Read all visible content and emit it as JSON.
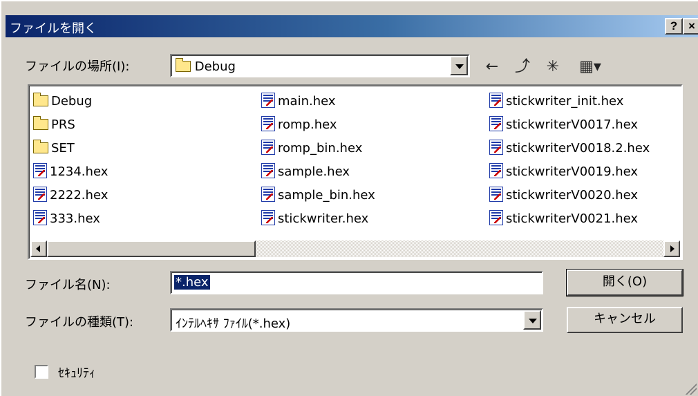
{
  "window": {
    "title": "ファイルを開く",
    "help_label": "?",
    "close_label": "×"
  },
  "location": {
    "label": "ファイルの場所(I):",
    "value": "Debug"
  },
  "toolbar": {
    "back_icon": "←",
    "up_icon": "⤴",
    "new_folder_icon": "✳",
    "view_icon": "▦▾"
  },
  "files": {
    "columns": [
      [
        {
          "name": "Debug",
          "icon": "folder-icon"
        },
        {
          "name": "PRS",
          "icon": "folder-icon"
        },
        {
          "name": "SET",
          "icon": "folder-icon"
        },
        {
          "name": "1234.hex",
          "icon": "hex-file-icon"
        },
        {
          "name": "2222.hex",
          "icon": "hex-file-icon"
        },
        {
          "name": "333.hex",
          "icon": "hex-file-icon"
        }
      ],
      [
        {
          "name": "main.hex",
          "icon": "hex-file-icon"
        },
        {
          "name": "romp.hex",
          "icon": "hex-file-icon"
        },
        {
          "name": "romp_bin.hex",
          "icon": "hex-file-icon"
        },
        {
          "name": "sample.hex",
          "icon": "hex-file-icon"
        },
        {
          "name": "sample_bin.hex",
          "icon": "hex-file-icon"
        },
        {
          "name": "stickwriter.hex",
          "icon": "hex-file-icon"
        }
      ],
      [
        {
          "name": "stickwriter_init.hex",
          "icon": "hex-file-icon"
        },
        {
          "name": "stickwriterV0017.hex",
          "icon": "hex-file-icon"
        },
        {
          "name": "stickwriterV0018.2.hex",
          "icon": "hex-file-icon"
        },
        {
          "name": "stickwriterV0019.hex",
          "icon": "hex-file-icon"
        },
        {
          "name": "stickwriterV0020.hex",
          "icon": "hex-file-icon"
        },
        {
          "name": "stickwriterV0021.hex",
          "icon": "hex-file-icon"
        }
      ]
    ]
  },
  "filename": {
    "label": "ファイル名(N):",
    "value": "*.hex"
  },
  "filetype": {
    "label": "ファイルの種類(T):",
    "value": "ｲﾝﾃﾙﾍｷｻ ﾌｧｲﾙ(*.hex)"
  },
  "buttons": {
    "open": "開く(O)",
    "cancel": "キャンセル"
  },
  "security": {
    "label": "ｾｷｭﾘﾃｨ",
    "checked": false
  },
  "colors": {
    "title_start": "#0a246a",
    "title_end": "#a6caf0",
    "face": "#d4d0c8"
  }
}
